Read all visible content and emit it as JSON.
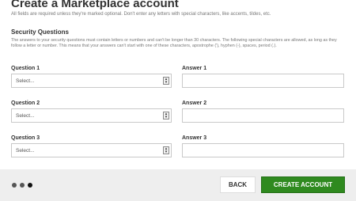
{
  "header": {
    "title": "Create a Marketplace account",
    "intro": "All fields are required unless they're marked optional. Don't enter any letters with special characters, like accents, tildes, etc."
  },
  "security": {
    "title": "Security Questions",
    "description": "The answers to your security questions must contain letters or numbers and can't be longer than 30 characters. The following special characters are allowed, as long as they follow a letter or number. This means that your answers can't start with one of these characters, apostrophe ('), hyphen (-), spaces, period (.)."
  },
  "questions": [
    {
      "label": "Question 1",
      "select_value": "Select...",
      "answer_label": "Answer 1",
      "answer_value": ""
    },
    {
      "label": "Question 2",
      "select_value": "Select...",
      "answer_label": "Answer 2",
      "answer_value": ""
    },
    {
      "label": "Question 3",
      "select_value": "Select...",
      "answer_label": "Answer 3",
      "answer_value": ""
    }
  ],
  "footer": {
    "back_label": "BACK",
    "create_label": "CREATE ACCOUNT",
    "progress": {
      "steps": 3,
      "current": 3
    }
  },
  "colors": {
    "accent": "#2f8a1f",
    "footer_bg": "#eeeeee"
  }
}
